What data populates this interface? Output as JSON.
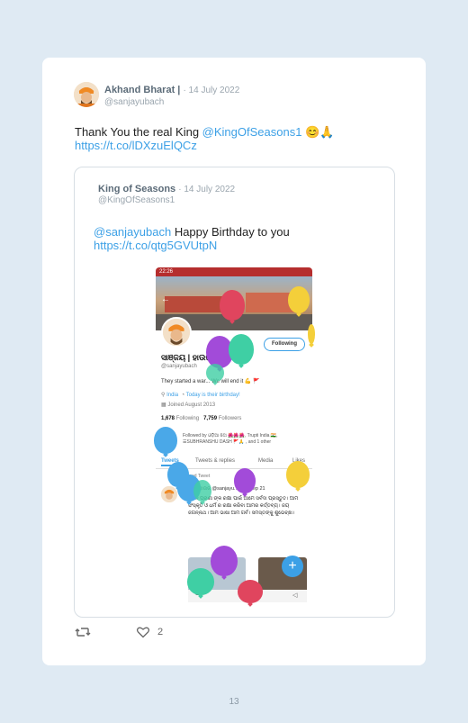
{
  "tweet": {
    "author_name": "Akhand Bharat |",
    "date": "· 14 July 2022",
    "handle": "@sanjayubach",
    "text_prefix": "Thank You the real King ",
    "mention": "@KingOfSeasons1",
    "emoji": " 😊🙏",
    "link": "https://t.co/lDXzuElQCz",
    "like_count": "2"
  },
  "quoted": {
    "author_name": "King of Seasons",
    "date": "· 14 July 2022",
    "handle": "@KingOfSeasons1",
    "mention": "@sanjayubach",
    "text": " Happy Birthday to you",
    "link": "https://t.co/qtg5GVUtpN"
  },
  "screenshot": {
    "status_time": "22:26",
    "follow_label": "Following",
    "profile_name": "ସାଞ୍ଜୟ | ହାଉଜ",
    "profile_handle": "@sanjayubach",
    "bio": "They started a war... We will end it 💪 🚩",
    "location": "India",
    "birthday": "Today is their birthday!",
    "joined": "Joined August 2013",
    "following_count": "1,678",
    "following_label": "Following",
    "followers_count": "7,759",
    "followers_label": "Followers",
    "followed_by": "Followed by ଓଡ଼ିଆ ଝିଅ 🌺🌺🌺, Trupti India 🇮🇳, ☰SUBHRANSHU DASH 🚩🙏 , and 1 other",
    "tabs": [
      "Tweets",
      "Tweets & replies",
      "Media",
      "Likes"
    ],
    "pinned_label": "Pinned Tweet",
    "pinned_author": "ସାଞ୍ଜୟ ହାଉଜ @sanjayu... · 18 Sep 21",
    "pinned_body": "ସକଳ ପ୍ରାଣୀ ଙ୍କ ରକ୍ଷା ପାଇଁ ଆମେ ସର୍ବଦା ପ୍ରସ୍ତୁତ। ଆମ ସଂସ୍କୃତି ଓ ଧର୍ମ ର ରକ୍ଷା କରିବା ଆମର କର୍ତ୍ତବ୍ୟ। ଜୟ ଜଗନ୍ନାଥ। ଆମ ଭାଷା ଆମ ଗର୍ବ। ସମସ୍ତଙ୍କୁ ଶୁଭେଚ୍ଛା।"
  },
  "page_number": "13",
  "colors": {
    "background": "#dfeaf3",
    "card": "#ffffff",
    "link": "#3ca0e6",
    "balloon_red": "#e0455e",
    "balloon_purple": "#a24bd9",
    "balloon_teal": "#3fcfa4",
    "balloon_yellow": "#f4cf3a",
    "balloon_blue": "#4aa8e8"
  },
  "icons": [
    "retweet-icon",
    "heart-icon",
    "plus-icon",
    "back-arrow-icon",
    "calendar-icon",
    "location-icon",
    "balloon-icon"
  ]
}
